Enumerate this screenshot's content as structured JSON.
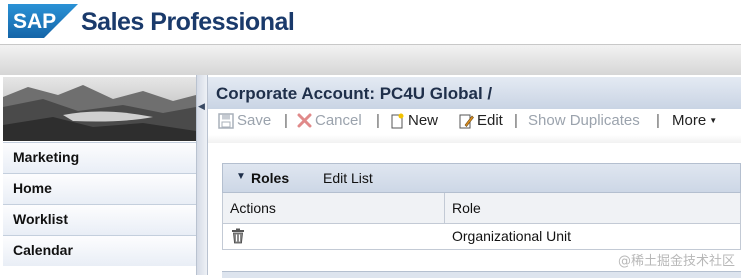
{
  "header": {
    "logo_text": "SAP",
    "app_title": "Sales Professional"
  },
  "sidebar": {
    "items": [
      {
        "label": "Marketing"
      },
      {
        "label": "Home"
      },
      {
        "label": "Worklist"
      },
      {
        "label": "Calendar"
      }
    ]
  },
  "main": {
    "title": "Corporate Account: PC4U Global /",
    "toolbar": {
      "save": "Save",
      "cancel": "Cancel",
      "new": "New",
      "edit": "Edit",
      "show_duplicates": "Show Duplicates",
      "more": "More",
      "separator": "|"
    },
    "roles_section": {
      "title": "Roles",
      "edit_list": "Edit List",
      "columns": [
        "Actions",
        "Role"
      ],
      "rows": [
        {
          "action_icon": "trash-icon",
          "role": "Organizational Unit"
        }
      ]
    }
  },
  "watermark": "@稀土掘金技术社区",
  "colors": {
    "brand_blue": "#1a3a6b",
    "sap_logo": "#1f7fc3",
    "panel_blue": "#c9d4e4",
    "disabled_text": "#9ba3ad",
    "cancel_red": "#e06666"
  }
}
